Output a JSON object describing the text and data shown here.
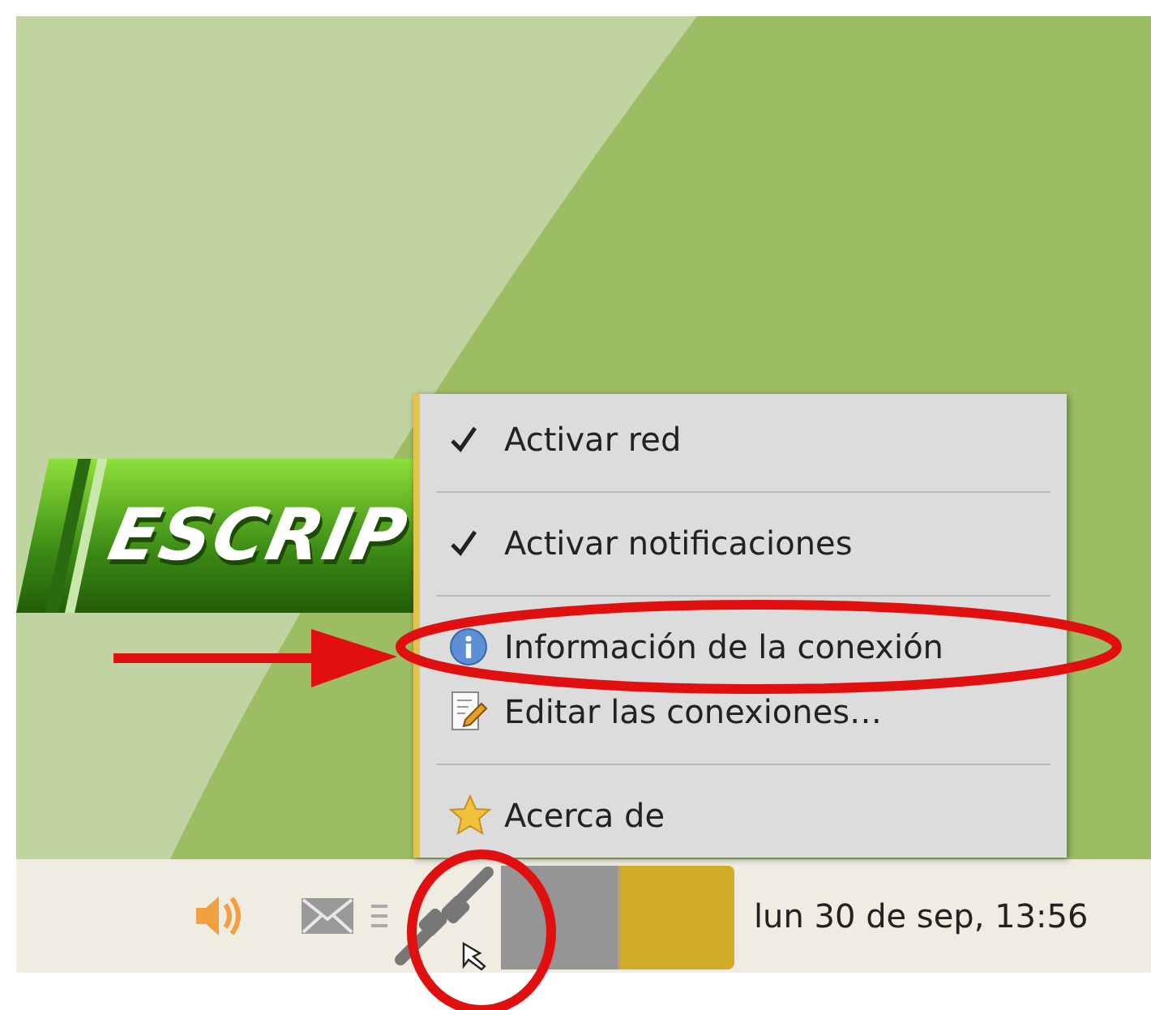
{
  "logo": {
    "text": "ESCRIP"
  },
  "menu": {
    "items": [
      {
        "kind": "check",
        "label": "Activar red",
        "checked": true
      },
      {
        "kind": "separator"
      },
      {
        "kind": "check",
        "label": "Activar notificaciones",
        "checked": true
      },
      {
        "kind": "separator"
      },
      {
        "kind": "info",
        "label": "Información de la conexión"
      },
      {
        "kind": "edit",
        "label": "Editar las conexiones…"
      },
      {
        "kind": "separator"
      },
      {
        "kind": "star",
        "label": "Acerca de"
      }
    ]
  },
  "taskbar": {
    "clock": "lun 30 de sep, 13:56"
  }
}
